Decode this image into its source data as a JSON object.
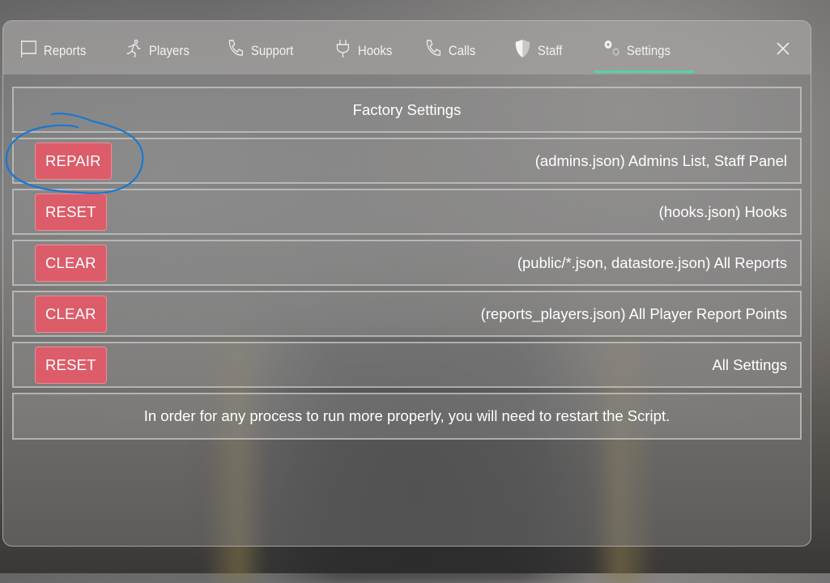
{
  "nav": {
    "tabs": [
      {
        "label": "Reports",
        "icon": "flag-icon",
        "active": false
      },
      {
        "label": "Players",
        "icon": "running-person-icon",
        "active": false
      },
      {
        "label": "Support",
        "icon": "phone-icon",
        "active": false
      },
      {
        "label": "Hooks",
        "icon": "plug-icon",
        "active": false
      },
      {
        "label": "Calls",
        "icon": "phone-icon",
        "active": false
      },
      {
        "label": "Staff",
        "icon": "shield-icon",
        "active": false
      },
      {
        "label": "Settings",
        "icon": "gears-icon",
        "active": true
      }
    ],
    "close_icon": "close-icon",
    "accent_color": "#4fd6a8"
  },
  "settings": {
    "header": "Factory Settings",
    "rows": [
      {
        "button": "REPAIR",
        "description": "(admins.json) Admins List, Staff Panel"
      },
      {
        "button": "RESET",
        "description": "(hooks.json) Hooks"
      },
      {
        "button": "CLEAR",
        "description": "(public/*.json, datastore.json) All Reports"
      },
      {
        "button": "CLEAR",
        "description": "(reports_players.json) All Player Report Points"
      },
      {
        "button": "RESET",
        "description": "All Settings"
      }
    ],
    "note": "In order for any process to run more properly, you will need to restart the Script.",
    "button_color": "#dc5c6a"
  },
  "annotation": {
    "type": "hand-drawn circle",
    "color": "#1a78d0",
    "target": "REPAIR"
  }
}
